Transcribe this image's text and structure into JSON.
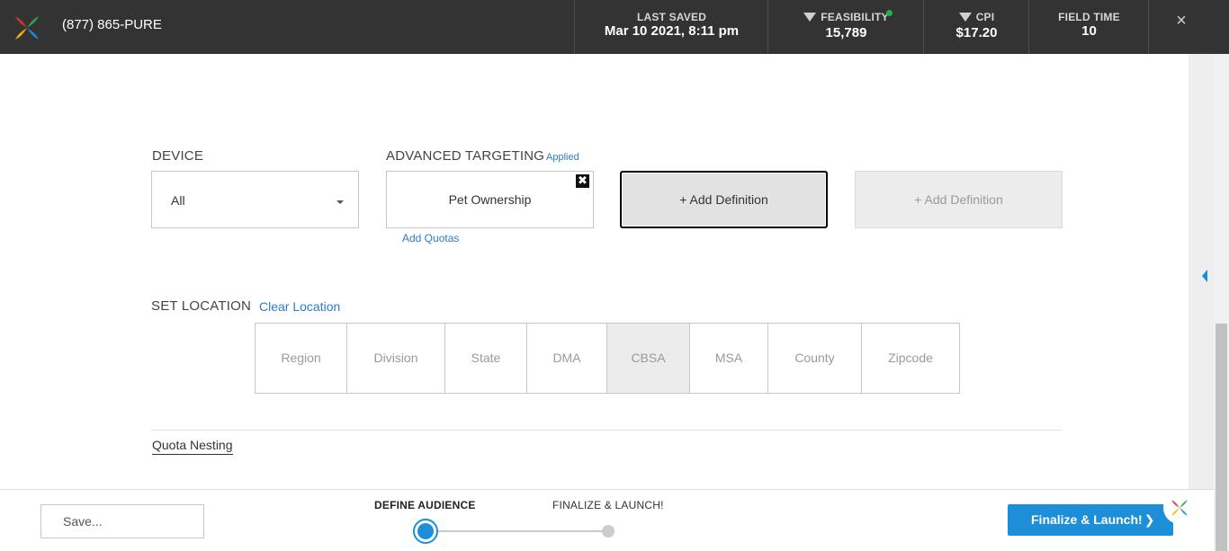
{
  "header": {
    "phone": "(877) 865-PURE",
    "last_saved_label": "LAST SAVED",
    "last_saved_value": "Mar 10 2021, 8:11 pm",
    "feasibility_label": "FEASIBILITY",
    "feasibility_value": "15,789",
    "cpi_label": "CPI",
    "cpi_value": "$17.20",
    "field_time_label": "FIELD TIME",
    "field_time_value": "10",
    "close_glyph": "×"
  },
  "device": {
    "label": "DEVICE",
    "selected": "All"
  },
  "advanced": {
    "label": "ADVANCED TARGETING",
    "applied": "Applied",
    "definition": "Pet Ownership",
    "remove_glyph": "✖",
    "add_quotas": "Add Quotas",
    "add_definition_1": "+ Add Definition",
    "add_definition_2": "+ Add Definition"
  },
  "location": {
    "label": "SET LOCATION",
    "clear": "Clear Location",
    "tabs": [
      "Region",
      "Division",
      "State",
      "DMA",
      "CBSA",
      "MSA",
      "County",
      "Zipcode"
    ],
    "active_tab": "CBSA"
  },
  "quota_nesting": "Quota Nesting",
  "footer": {
    "save": "Save...",
    "step1": "DEFINE AUDIENCE",
    "step2": "FINALIZE & LAUNCH!",
    "finalize": "Finalize & Launch!",
    "chevron": "❯"
  },
  "colors": {
    "accent": "#1c8fd8",
    "link": "#2e7cc4",
    "topbar": "#333333"
  }
}
